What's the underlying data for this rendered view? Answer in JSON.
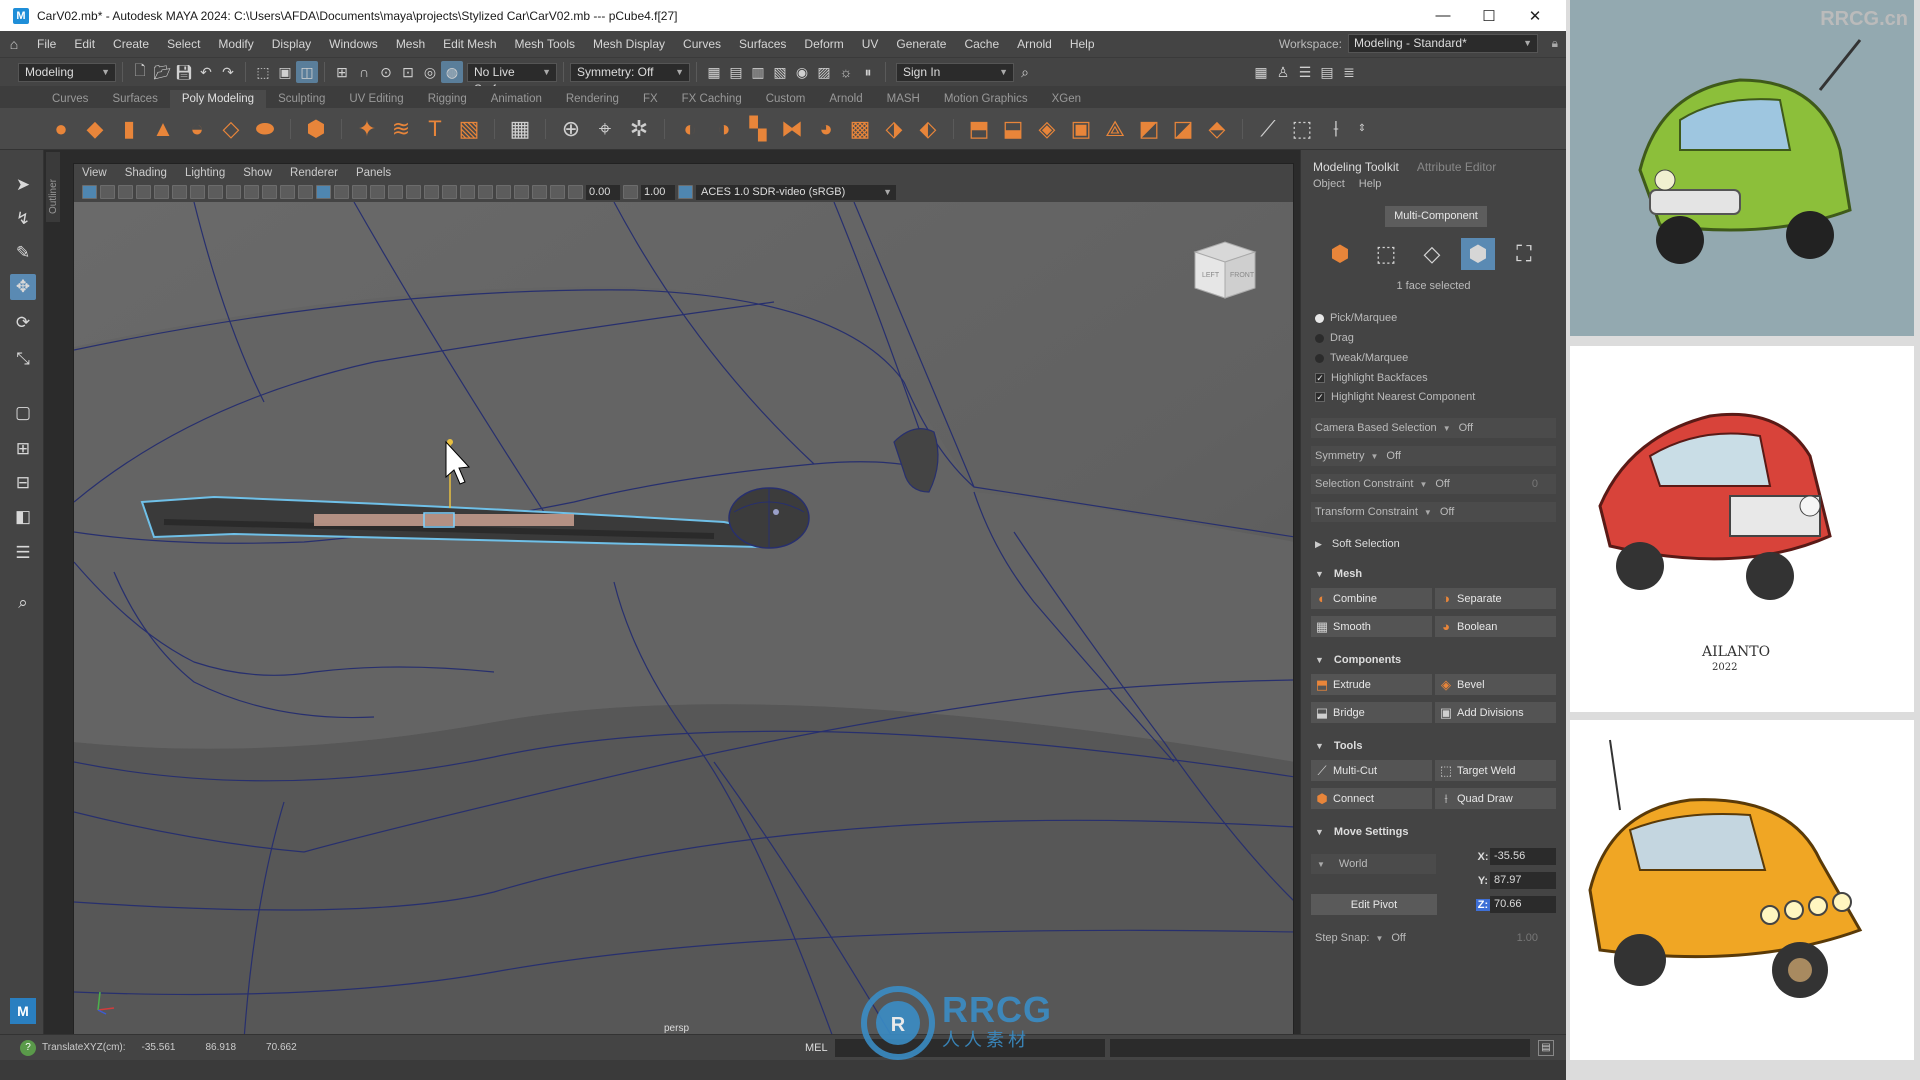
{
  "title_bar": {
    "title": "CarV02.mb* - Autodesk MAYA 2024: C:\\Users\\AFDA\\Documents\\maya\\projects\\Stylized Car\\CarV02.mb  ---  pCube4.f[27]",
    "minimize": "—",
    "maximize": "☐",
    "close": "✕"
  },
  "menu": [
    "File",
    "Edit",
    "Create",
    "Select",
    "Modify",
    "Display",
    "Windows",
    "Mesh",
    "Edit Mesh",
    "Mesh Tools",
    "Mesh Display",
    "Curves",
    "Surfaces",
    "Deform",
    "UV",
    "Generate",
    "Cache",
    "Arnold",
    "Help"
  ],
  "workspace": {
    "label": "Workspace:",
    "value": "Modeling - Standard*"
  },
  "status_line": {
    "menu_set": "Modeling",
    "live_surface": "No Live Surface",
    "symmetry": "Symmetry: Off",
    "sign_in": "Sign In"
  },
  "shelf_tabs": [
    "Curves",
    "Surfaces",
    "Poly Modeling",
    "Sculpting",
    "UV Editing",
    "Rigging",
    "Animation",
    "Rendering",
    "FX",
    "FX Caching",
    "Custom",
    "Arnold",
    "MASH",
    "Motion Graphics",
    "XGen"
  ],
  "active_shelf_tab": "Poly Modeling",
  "outliner_tab": "Outliner",
  "viewport": {
    "menus": [
      "View",
      "Shading",
      "Lighting",
      "Show",
      "Renderer",
      "Panels"
    ],
    "near_value": "0.00",
    "far_value": "1.00",
    "color_space": "ACES 1.0 SDR-video (sRGB)",
    "camera_label": "persp",
    "viewcube_left": "LEFT",
    "viewcube_front": "FRONT"
  },
  "modeling_toolkit": {
    "tabs": [
      "Modeling Toolkit",
      "Attribute Editor"
    ],
    "submenu": [
      "Object",
      "Help"
    ],
    "multi_component": "Multi-Component",
    "selection_info": "1 face selected",
    "pick_modes": [
      "Pick/Marquee",
      "Drag",
      "Tweak/Marquee"
    ],
    "checkboxes": [
      "Highlight Backfaces",
      "Highlight Nearest Component"
    ],
    "options": [
      {
        "label": "Camera Based Selection",
        "value": "Off"
      },
      {
        "label": "Symmetry",
        "value": "Off"
      },
      {
        "label": "Selection Constraint",
        "value": "Off",
        "extra": "0"
      },
      {
        "label": "Transform Constraint",
        "value": "Off"
      }
    ],
    "soft_selection": "Soft Selection",
    "sections": {
      "mesh": {
        "title": "Mesh",
        "buttons": [
          "Combine",
          "Separate",
          "Smooth",
          "Boolean"
        ]
      },
      "components": {
        "title": "Components",
        "buttons": [
          "Extrude",
          "Bevel",
          "Bridge",
          "Add Divisions"
        ]
      },
      "tools": {
        "title": "Tools",
        "buttons": [
          "Multi-Cut",
          "Target Weld",
          "Connect",
          "Quad Draw"
        ]
      }
    },
    "move_settings": {
      "title": "Move Settings",
      "space": "World",
      "edit_pivot": "Edit Pivot",
      "x_label": "X:",
      "x": "-35.56",
      "y_label": "Y:",
      "y": "87.97",
      "z_label": "Z:",
      "z": "70.66",
      "step_snap_label": "Step Snap:",
      "step_snap": "Off",
      "step_value": "1.00"
    }
  },
  "help_line": {
    "text": "TranslateXYZ(cm):",
    "x": "-35.561",
    "y": "86.918",
    "z": "70.662",
    "mel": "MEL"
  },
  "references": {
    "watermark": "RRCG.cn",
    "signature": "AILANTO",
    "signature_year": "2022"
  },
  "watermark": {
    "logo": "RRCG",
    "subtitle": "人人素材"
  },
  "colors": {
    "maya_bg": "#444444",
    "viewport_bg": "#5e5e5e",
    "accent_blue": "#5a8ab3",
    "poly_orange": "#e8853a"
  }
}
